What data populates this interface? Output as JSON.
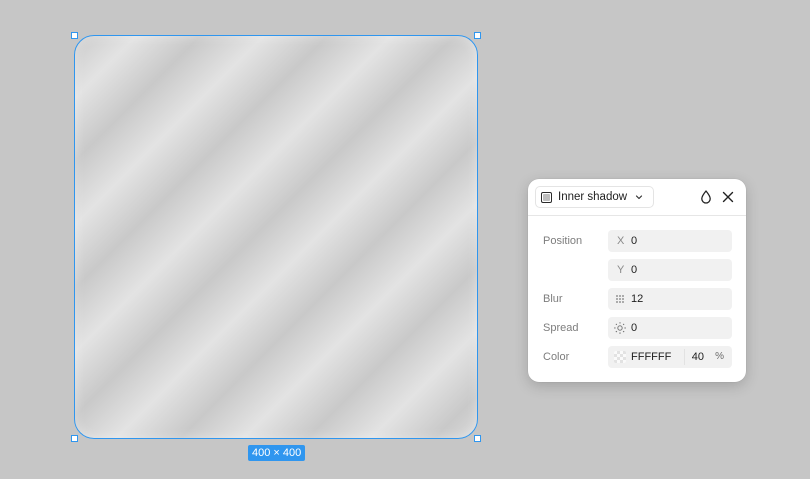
{
  "canvas": {
    "background": "#c6c6c6",
    "selection_color": "#2f96ef",
    "size_label": "400 × 400"
  },
  "effect_panel": {
    "effect_type": "Inner shadow",
    "icons": {
      "type": "inner-shadow-icon",
      "dropdown": "chevron-down-icon",
      "visibility": "drop-icon",
      "close": "close-icon"
    },
    "position_label": "Position",
    "x_prefix": "X",
    "x_value": "0",
    "y_prefix": "Y",
    "y_value": "0",
    "blur_label": "Blur",
    "blur_value": "12",
    "spread_label": "Spread",
    "spread_value": "0",
    "color_label": "Color",
    "color_hex": "FFFFFF",
    "color_opacity": "40",
    "opacity_unit": "%"
  }
}
